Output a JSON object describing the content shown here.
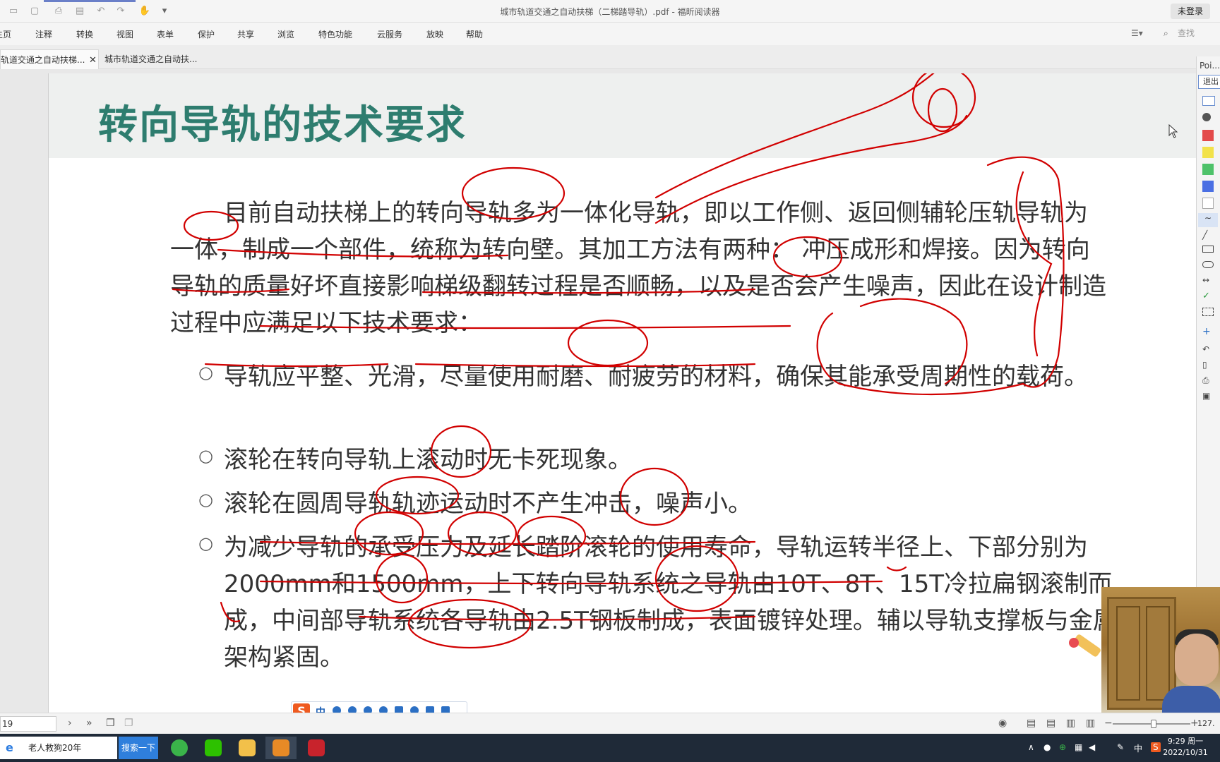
{
  "window": {
    "title": "城市轨道交通之自动扶梯（二梯踏导轨）.pdf - 福昕阅读器",
    "login_label": "未登录"
  },
  "menu": {
    "items": [
      "主页",
      "注释",
      "转换",
      "视图",
      "表单",
      "保护",
      "共享",
      "浏览",
      "特色功能",
      "云服务",
      "放映",
      "帮助"
    ],
    "search_placeholder": "查找"
  },
  "tabs": [
    {
      "label": "轨道交通之自动扶梯...",
      "active": true
    },
    {
      "label": "城市轨道交通之自动扶...",
      "active": false
    }
  ],
  "slide": {
    "title": "转向导轨的技术要求",
    "paragraph": "目前自动扶梯上的转向导轨多为一体化导轨，即以工作侧、返回侧辅轮压轨导轨为一体，制成一个部件，统称为转向壁。其加工方法有两种： 冲压成形和焊接。因为转向导轨的质量好坏直接影响梯级翻转过程是否顺畅，以及是否会产生噪声，因此在设计制造过程中应满足以下技术要求：",
    "bullet_mark": "○",
    "bullets": [
      "导轨应平整、光滑，尽量使用耐磨、耐疲劳的材料，确保其能承受周期性的载荷。",
      "滚轮在转向导轨上滚动时无卡死现象。",
      "滚轮在圆周导轨轨迹运动时不产生冲击，噪声小。",
      "为减少导轨的承受压力及延长踏阶滚轮的使用寿命，导轨运转半径上、下部分别为2000mm和1500mm，上下转向导轨系统之导轨由10T、8T、15T冷拉扁钢滚制而成，中间部导轨系统各导轨由2.5T钢板制成，表面镀锌处理。辅以导轨支撑板与金属架构紧固。"
    ]
  },
  "annotation_panel": {
    "header": "Poi...",
    "exit_label": "退出"
  },
  "status": {
    "page_number": "19",
    "zoom": "127."
  },
  "ime": {
    "logo": "S",
    "mode": "中"
  },
  "taskbar": {
    "search_text": "老人救狗20年",
    "search_button": "搜索一下",
    "tray_lang": "中",
    "time": "9:29 周一",
    "date": "2022/10/31"
  },
  "colors": {
    "title_green": "#2e7d6f",
    "ink_red": "#d10000",
    "taskbar": "#1f2a38"
  }
}
